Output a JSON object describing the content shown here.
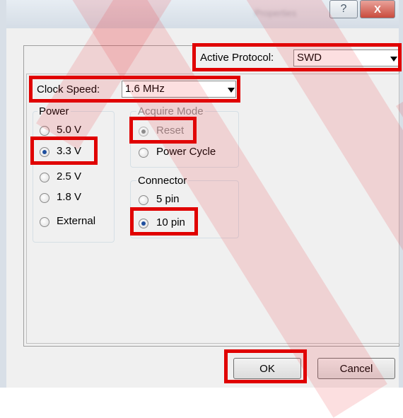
{
  "titlebar": {
    "title": "Properties",
    "help_label": "?",
    "close_label": "X"
  },
  "protocol": {
    "label": "Active Protocol:",
    "value": "SWD"
  },
  "clock": {
    "label": "Clock Speed:",
    "value": "1.6 MHz"
  },
  "power": {
    "title": "Power",
    "options": [
      {
        "label": "5.0 V",
        "checked": false
      },
      {
        "label": "3.3 V",
        "checked": true
      },
      {
        "label": "2.5 V",
        "checked": false
      },
      {
        "label": "1.8 V",
        "checked": false
      },
      {
        "label": "External",
        "checked": false
      }
    ]
  },
  "acquire": {
    "title": "Acquire Mode",
    "options": [
      {
        "label": "Reset",
        "checked": true,
        "disabled": true
      },
      {
        "label": "Power Cycle",
        "checked": false,
        "disabled": false
      }
    ]
  },
  "connector": {
    "title": "Connector",
    "options": [
      {
        "label": "5 pin",
        "checked": false
      },
      {
        "label": "10 pin",
        "checked": true
      }
    ]
  },
  "buttons": {
    "ok_label": "OK",
    "cancel_label": "Cancel"
  },
  "colors": {
    "highlight": "#e00000",
    "watermark": "#ec2832"
  }
}
